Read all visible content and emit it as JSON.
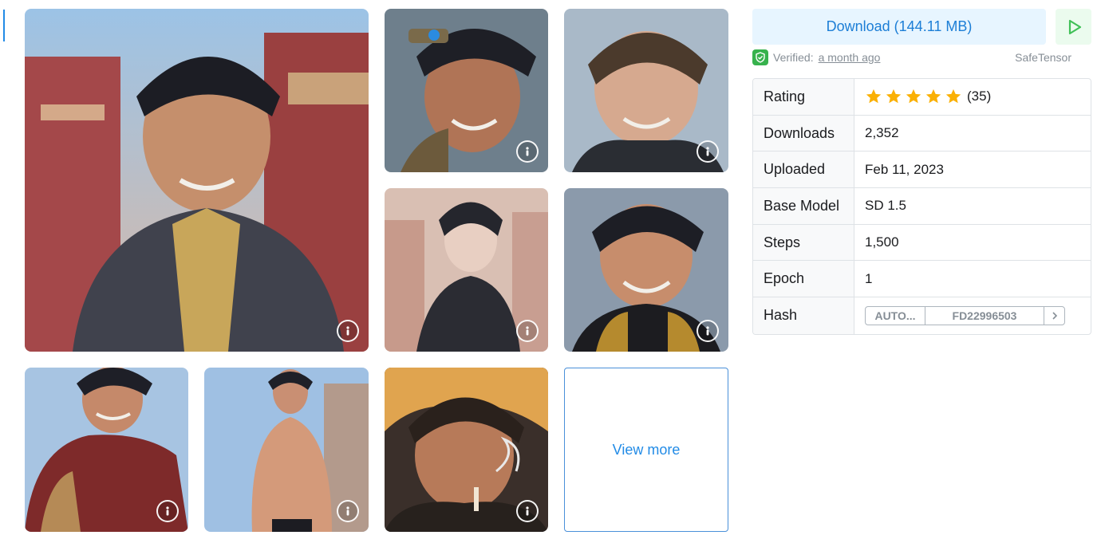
{
  "gallery": {
    "tiles": [
      {
        "id": "tile-1",
        "icon": "info-icon"
      },
      {
        "id": "tile-2",
        "icon": "info-icon"
      },
      {
        "id": "tile-3",
        "icon": "info-icon"
      },
      {
        "id": "tile-4",
        "icon": "info-icon"
      },
      {
        "id": "tile-5",
        "icon": "info-icon"
      },
      {
        "id": "tile-6",
        "icon": "info-icon"
      },
      {
        "id": "tile-7",
        "icon": "info-icon"
      },
      {
        "id": "tile-8",
        "icon": "info-icon"
      }
    ],
    "view_more_label": "View more"
  },
  "download": {
    "label": "Download (144.11 MB)",
    "run_icon": "play-icon"
  },
  "verification": {
    "prefix": "Verified:",
    "time": "a month ago",
    "format": "SafeTensor"
  },
  "details": {
    "rating": {
      "label": "Rating",
      "stars": 5,
      "count": "(35)"
    },
    "downloads": {
      "label": "Downloads",
      "value": "2,352"
    },
    "uploaded": {
      "label": "Uploaded",
      "value": "Feb 11, 2023"
    },
    "base_model": {
      "label": "Base Model",
      "value": "SD 1.5"
    },
    "steps": {
      "label": "Steps",
      "value": "1,500"
    },
    "epoch": {
      "label": "Epoch",
      "value": "1"
    },
    "hash": {
      "label": "Hash",
      "type": "AUTO...",
      "value": "FD22996503",
      "next_icon": "chevron-right-icon"
    }
  },
  "colors": {
    "accent": "#228be6",
    "download_bg": "#e7f5ff",
    "run_bg": "#ebfbee",
    "run_icon": "#40c057",
    "star": "#fab005",
    "verified": "#37b24d"
  }
}
